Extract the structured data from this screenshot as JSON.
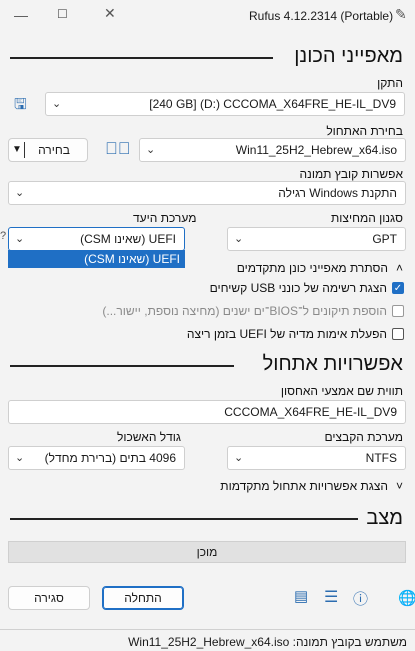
{
  "window": {
    "title": "Rufus 4.12.2314 (Portable)",
    "controls": [
      "close",
      "maximize",
      "minimize"
    ]
  },
  "drive_properties": {
    "title": "מאפייני הכונן",
    "device_label": "התקן",
    "device_value": "[240 GB] (D:) CCCOMA_X64FRE_HE-IL_DV9",
    "boot_selection_label": "בחירת האתחול",
    "boot_selection_value": "Win11_25H2_Hebrew_x64.iso",
    "select_button": "בחירה",
    "image_option_label": "אפשרות קובץ תמונה",
    "image_option_value": "התקנת Windows רגילה",
    "partition_scheme_label": "סגנון המחיצות",
    "partition_scheme_value": "GPT",
    "target_system_label": "מערכת היעד",
    "target_system_value": "UEFI (שאינו CSM)",
    "target_system_options": [
      "UEFI (שאינו CSM)"
    ],
    "advanced_toggle": "הסתרת מאפייני כונן מתקדמים",
    "opt_list_usb": "הצגת רשימה של כונני USB קשיחים",
    "opt_bios_fixes": "הוספת תיקונים ל־BIOS־ים ישנים (מחיצה נוספת, יישור...)",
    "opt_uefi_validation": "הפעלת אימות מדיה של UEFI בזמן ריצה"
  },
  "format_options": {
    "title": "אפשרויות אתחול",
    "volume_label_label": "תווית שם אמצעי האחסון",
    "volume_label_value": "CCCOMA_X64FRE_HE-IL_DV9",
    "file_system_label": "מערכת הקבצים",
    "file_system_value": "NTFS",
    "cluster_size_label": "גודל האשכול",
    "cluster_size_value": "4096 בתים (ברירת מחדל)",
    "advanced_toggle": "הצגת אפשרויות אתחול מתקדמות"
  },
  "status": {
    "title": "מצב",
    "progress_text": "מוכן",
    "progress_fraction": 0
  },
  "actions": {
    "start": "התחלה",
    "close": "סגירה"
  },
  "statusbar": {
    "text": "משתמש בקובץ תמונה: Win11_25H2_Hebrew_x64.iso"
  },
  "colors": {
    "accent": "#1f6fc5",
    "background": "#f3f3f3"
  }
}
